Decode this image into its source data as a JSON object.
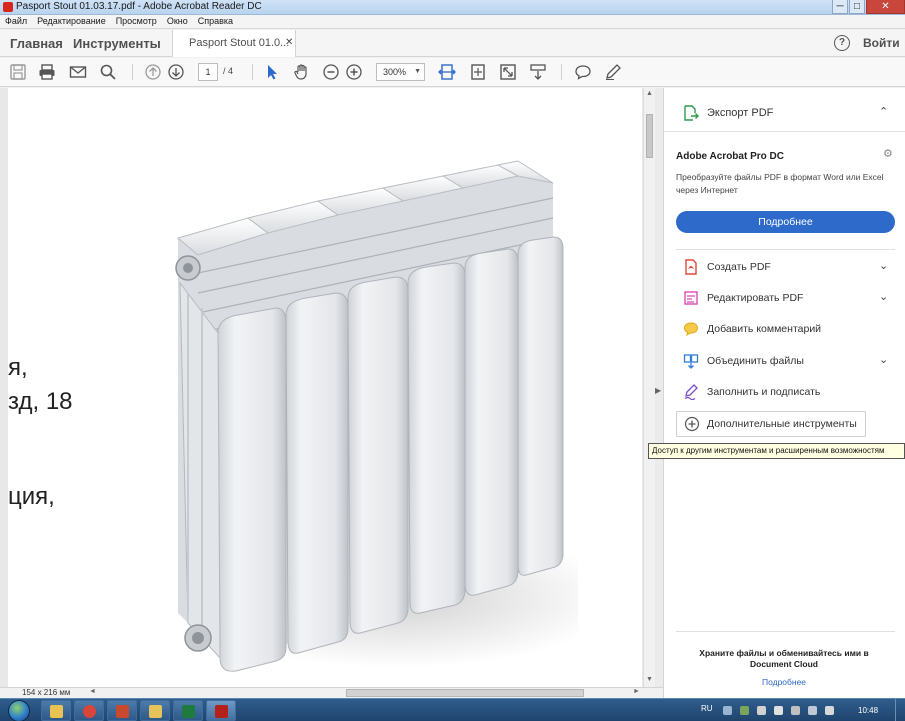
{
  "window": {
    "title": "Pasport Stout 01.03.17.pdf - Adobe Acrobat Reader DC",
    "minimize": "─",
    "maximize": "□",
    "close": "✕"
  },
  "menu": [
    "Файл",
    "Редактирование",
    "Просмотр",
    "Окно",
    "Справка"
  ],
  "nav": {
    "home": "Главная",
    "tools": "Инструменты",
    "doc_tab": "Pasport Stout 01.0...",
    "doc_tab_close": "✕",
    "help": "?",
    "signin": "Войти"
  },
  "toolbar": {
    "page_current": "1",
    "page_total": "/ 4",
    "zoom": "300%",
    "zoom_chevron": "▼",
    "icons": [
      "save-icon",
      "print-icon",
      "email-icon",
      "search-icon",
      "prev-page-icon",
      "next-page-icon",
      "select-cursor-icon",
      "hand-icon",
      "zoom-out-icon",
      "zoom-in-icon",
      "fit-width-icon",
      "fit-page-icon",
      "fullscreen-icon",
      "scroll-mode-icon",
      "comment-icon",
      "pen-icon"
    ]
  },
  "document": {
    "text_lines": [
      "я,",
      "зд, 18",
      "ция,"
    ],
    "scroll_up": "▲",
    "scroll_down": "▼"
  },
  "status": {
    "dims": "154 x 216 мм",
    "left_arrow": "◄",
    "right_arrow": "►",
    "panel_toggle": "▶"
  },
  "right_pane": {
    "export": {
      "label": "Экспорт PDF",
      "chevron": "⌃",
      "icon": "export-pdf-icon",
      "color": "#2f9a4e"
    },
    "promo": {
      "title": "Adobe Acrobat Pro DC",
      "desc": "Преобразуйте файлы PDF в формат Word или Excel через Интернет",
      "button": "Подробнее",
      "settings_icon": "⚙"
    },
    "tools": [
      {
        "label": "Создать PDF",
        "chevron": "⌄",
        "icon": "create-pdf-icon",
        "color": "#e0463b"
      },
      {
        "label": "Редактировать PDF",
        "chevron": "⌄",
        "icon": "edit-pdf-icon",
        "color": "#d94cb4"
      },
      {
        "label": "Добавить комментарий",
        "chevron": "",
        "icon": "comment-icon",
        "color": "#f2b417"
      },
      {
        "label": "Объединить файлы",
        "chevron": "⌄",
        "icon": "combine-files-icon",
        "color": "#2f7fd6"
      },
      {
        "label": "Заполнить и подписать",
        "chevron": "",
        "icon": "fill-sign-icon",
        "color": "#7a4fc9"
      }
    ],
    "more_tools": {
      "label": "Дополнительные инструменты",
      "icon": "plus-circle-icon"
    },
    "tooltip": "Доступ к другим инструментам и расширенным возможностям",
    "cloud_text": "Храните файлы и обменивайтесь ими в Document Cloud",
    "cloud_link": "Подробнее"
  },
  "taskbar": {
    "lang": "RU",
    "time": "10:48",
    "apps": [
      {
        "name": "explorer-icon",
        "color": "#e8c350"
      },
      {
        "name": "chrome-icon",
        "color": "#d9453a"
      },
      {
        "name": "app-icon",
        "color": "#c9492f"
      },
      {
        "name": "folder-icon",
        "color": "#e6c25b"
      },
      {
        "name": "excel-icon",
        "color": "#1f7a3e"
      },
      {
        "name": "acrobat-icon",
        "color": "#b3211a"
      }
    ]
  }
}
